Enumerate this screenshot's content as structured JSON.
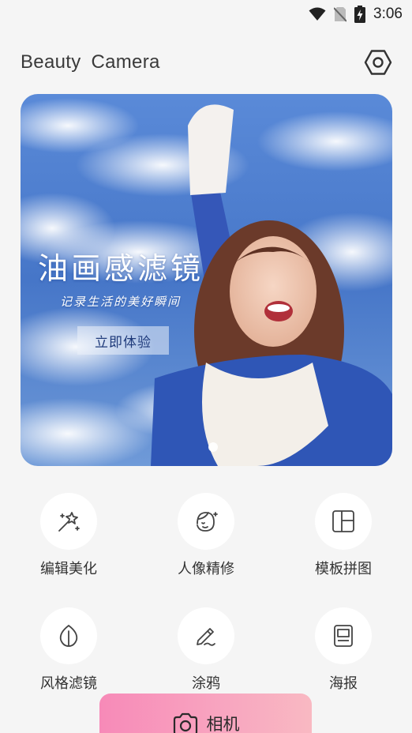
{
  "status_bar": {
    "time": "3:06",
    "icons": [
      "wifi-icon",
      "no-sim-icon",
      "battery-charging-icon"
    ]
  },
  "header": {
    "title": "Beauty  Camera",
    "settings_icon": "hexagon-settings-icon"
  },
  "banner": {
    "title": "油画感滤镜",
    "subtitle": "记录生活的美好瞬间",
    "button_label": "立即体验",
    "page_indicator": {
      "current": 1
    }
  },
  "tools": [
    {
      "label": "编辑美化",
      "icon": "magic-wand-icon"
    },
    {
      "label": "人像精修",
      "icon": "face-retouch-icon"
    },
    {
      "label": "模板拼图",
      "icon": "collage-grid-icon"
    },
    {
      "label": "风格滤镜",
      "icon": "leaf-filter-icon"
    },
    {
      "label": "涂鸦",
      "icon": "pen-doodle-icon"
    },
    {
      "label": "海报",
      "icon": "poster-icon"
    }
  ],
  "camera": {
    "label": "相机",
    "icon": "camera-icon"
  },
  "colors": {
    "background": "#f5f5f5",
    "camera_gradient_start": "#f78ab8",
    "camera_gradient_end": "#f9b9c2",
    "banner_sky": "#3f6fc4"
  }
}
